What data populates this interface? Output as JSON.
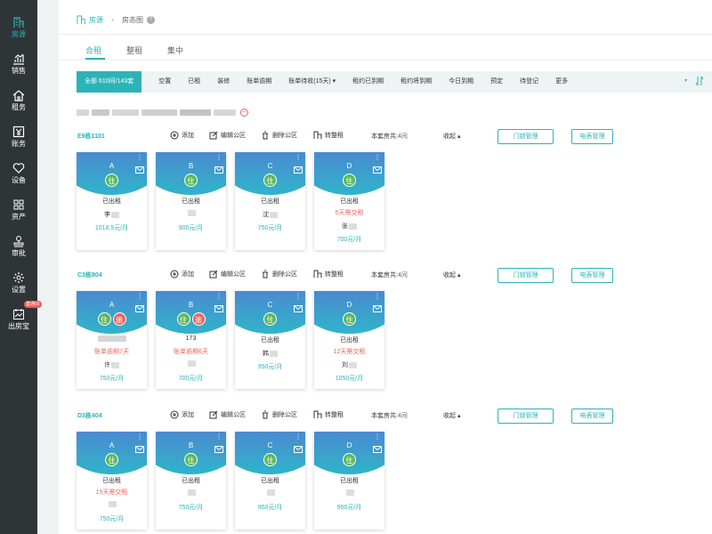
{
  "sidebar": {
    "items": [
      {
        "label": "房源",
        "icon": "building-icon",
        "active": true
      },
      {
        "label": "销售",
        "icon": "sales-chart-icon"
      },
      {
        "label": "租务",
        "icon": "house-icon"
      },
      {
        "label": "账务",
        "icon": "yen-icon"
      },
      {
        "label": "设备",
        "icon": "heart-icon"
      },
      {
        "label": "资产",
        "icon": "grid-icon"
      },
      {
        "label": "审批",
        "icon": "approval-stamp-icon"
      },
      {
        "label": "设置",
        "icon": "gear-icon"
      },
      {
        "label": "出房宝",
        "icon": "calendar-chart-icon",
        "badge": "直通56"
      }
    ]
  },
  "breadcrumb": {
    "root": "房源",
    "current": "房态图",
    "help": "?"
  },
  "tabs": [
    {
      "label": "合租",
      "active": true
    },
    {
      "label": "整租"
    },
    {
      "label": "集中"
    }
  ],
  "filters": {
    "all": "全部  610间/143套",
    "items": [
      "空置",
      "已租",
      "装修",
      "账单逾期",
      "账单待收(15天) ▾",
      "租约已到期",
      "租约将到期",
      "今日到期",
      "预定",
      "待登记",
      "更多"
    ],
    "arrow": "▾",
    "sort_icon": "sort-icon"
  },
  "address": {
    "text": "小区地址已隐藏",
    "remove_icon": "minus-circle-icon"
  },
  "actions": {
    "add": "添加",
    "edit": "编辑公区",
    "delete": "删除公区",
    "convert": "转整租",
    "share_label": "本套房共:",
    "collapse": "收起",
    "lock_btn": "门锁管理",
    "meter_btn": "电表管理"
  },
  "buildings": [
    {
      "name": "E9栋1101",
      "rooms": "4间",
      "cards": [
        {
          "letter": "A",
          "badges": [
            "住"
          ],
          "status": "已出租",
          "warn": "",
          "name": "李",
          "price": "1018.5元/月"
        },
        {
          "letter": "B",
          "badges": [
            "住"
          ],
          "status": "已出租",
          "warn": "",
          "name": "",
          "price": "900元/月"
        },
        {
          "letter": "C",
          "badges": [
            "住"
          ],
          "status": "已出租",
          "warn": "",
          "name": "沈",
          "price": "750元/月"
        },
        {
          "letter": "D",
          "badges": [
            "住"
          ],
          "status": "已出租",
          "warn": "5天需交租",
          "name": "张",
          "price": "700元/月"
        }
      ]
    },
    {
      "name": "C3栋804",
      "rooms": "4间",
      "cards": [
        {
          "letter": "A",
          "badges": [
            "住",
            "逾"
          ],
          "status": "",
          "warn": "账单逾期7天",
          "name": "许",
          "price": "750元/月"
        },
        {
          "letter": "B",
          "badges": [
            "住",
            "逾"
          ],
          "status": "173",
          "warn": "账单逾期6天",
          "name": "",
          "price": "700元/月"
        },
        {
          "letter": "C",
          "badges": [
            "住"
          ],
          "status": "已出租",
          "warn": "",
          "name": "韩",
          "price": "950元/月"
        },
        {
          "letter": "D",
          "badges": [
            "住"
          ],
          "status": "已出租",
          "warn": "12天需交租",
          "name": "刘",
          "price": "1050元/月"
        }
      ]
    },
    {
      "name": "D3栋404",
      "rooms": "4间",
      "cards": [
        {
          "letter": "A",
          "badges": [
            "住"
          ],
          "status": "已出租",
          "warn": "15天需交租",
          "name": "",
          "price": "750元/月"
        },
        {
          "letter": "B",
          "badges": [
            "住"
          ],
          "status": "已出租",
          "warn": "",
          "name": "",
          "price": "750元/月"
        },
        {
          "letter": "C",
          "badges": [
            "住"
          ],
          "status": "已出租",
          "warn": "",
          "name": "",
          "price": "950元/月"
        },
        {
          "letter": "D",
          "badges": [
            "住"
          ],
          "status": "已出租",
          "warn": "",
          "name": "",
          "price": "950元/月"
        }
      ]
    }
  ],
  "colors": {
    "accent": "#2bb3b8",
    "warn": "#f0625d",
    "live": "#5bb75b",
    "sidebar": "#2f3437"
  }
}
